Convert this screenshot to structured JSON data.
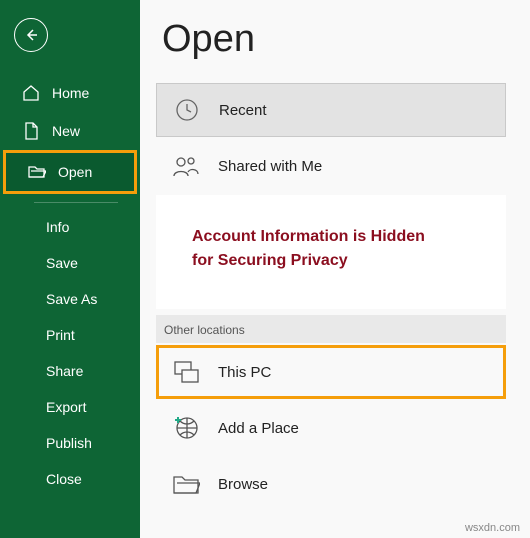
{
  "title": "Open",
  "sidebar": {
    "items": [
      {
        "label": "Home"
      },
      {
        "label": "New"
      },
      {
        "label": "Open"
      },
      {
        "label": "Info"
      },
      {
        "label": "Save"
      },
      {
        "label": "Save As"
      },
      {
        "label": "Print"
      },
      {
        "label": "Share"
      },
      {
        "label": "Export"
      },
      {
        "label": "Publish"
      },
      {
        "label": "Close"
      }
    ]
  },
  "main": {
    "recent": "Recent",
    "shared": "Shared with Me",
    "privacy_line1": "Account Information is Hidden",
    "privacy_line2": "for Securing Privacy",
    "other_locations": "Other locations",
    "this_pc": "This PC",
    "add_place": "Add a Place",
    "browse": "Browse"
  },
  "watermark": "wsxdn.com"
}
